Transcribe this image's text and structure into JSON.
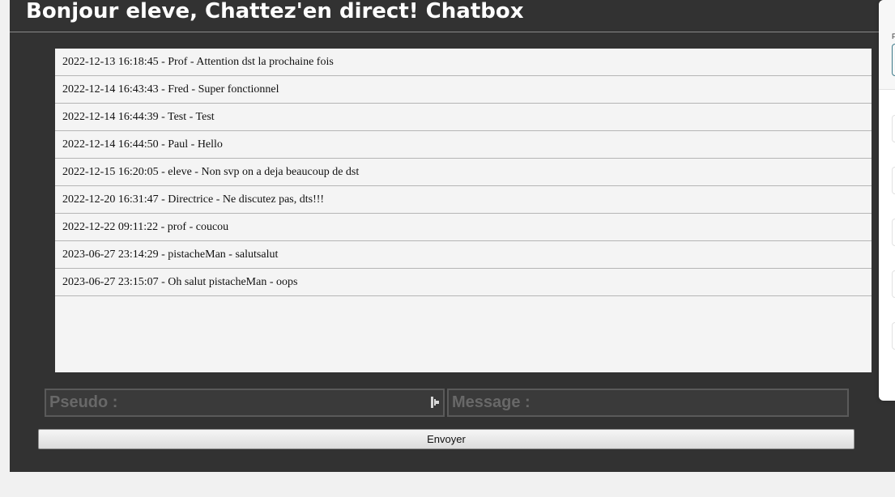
{
  "header": {
    "title": "Bonjour eleve, Chattez'en direct! Chatbox"
  },
  "messages": [
    "2022-12-13 16:18:45 - Prof - Attention dst la prochaine fois",
    "2022-12-14 16:43:43 - Fred - Super fonctionnel",
    "2022-12-14 16:44:39 - Test - Test",
    "2022-12-14 16:44:50 - Paul - Hello",
    "2022-12-15 16:20:05 - eleve - Non svp on a deja beaucoup de dst",
    "2022-12-20 16:31:47 - Directrice - Ne discutez pas, dts!!!",
    "2022-12-22 09:11:22 - prof - coucou",
    "2023-06-27 23:14:29 - pistacheMan - salutsalut",
    "2023-06-27 23:15:07 - Oh salut pistacheMan - oops"
  ],
  "form": {
    "pseudo_placeholder": "Pseudo :",
    "message_placeholder": "Message :",
    "send_label": "Envoyer"
  },
  "side_panel": {
    "label": "F"
  },
  "icons": {
    "autofill": "autofill-key-icon"
  },
  "colors": {
    "panel_background": "#323232",
    "page_background": "#f1f1f1",
    "message_list_background": "#f4f4f4",
    "input_background": "#3a3a3a",
    "title_text": "#ffffff"
  }
}
